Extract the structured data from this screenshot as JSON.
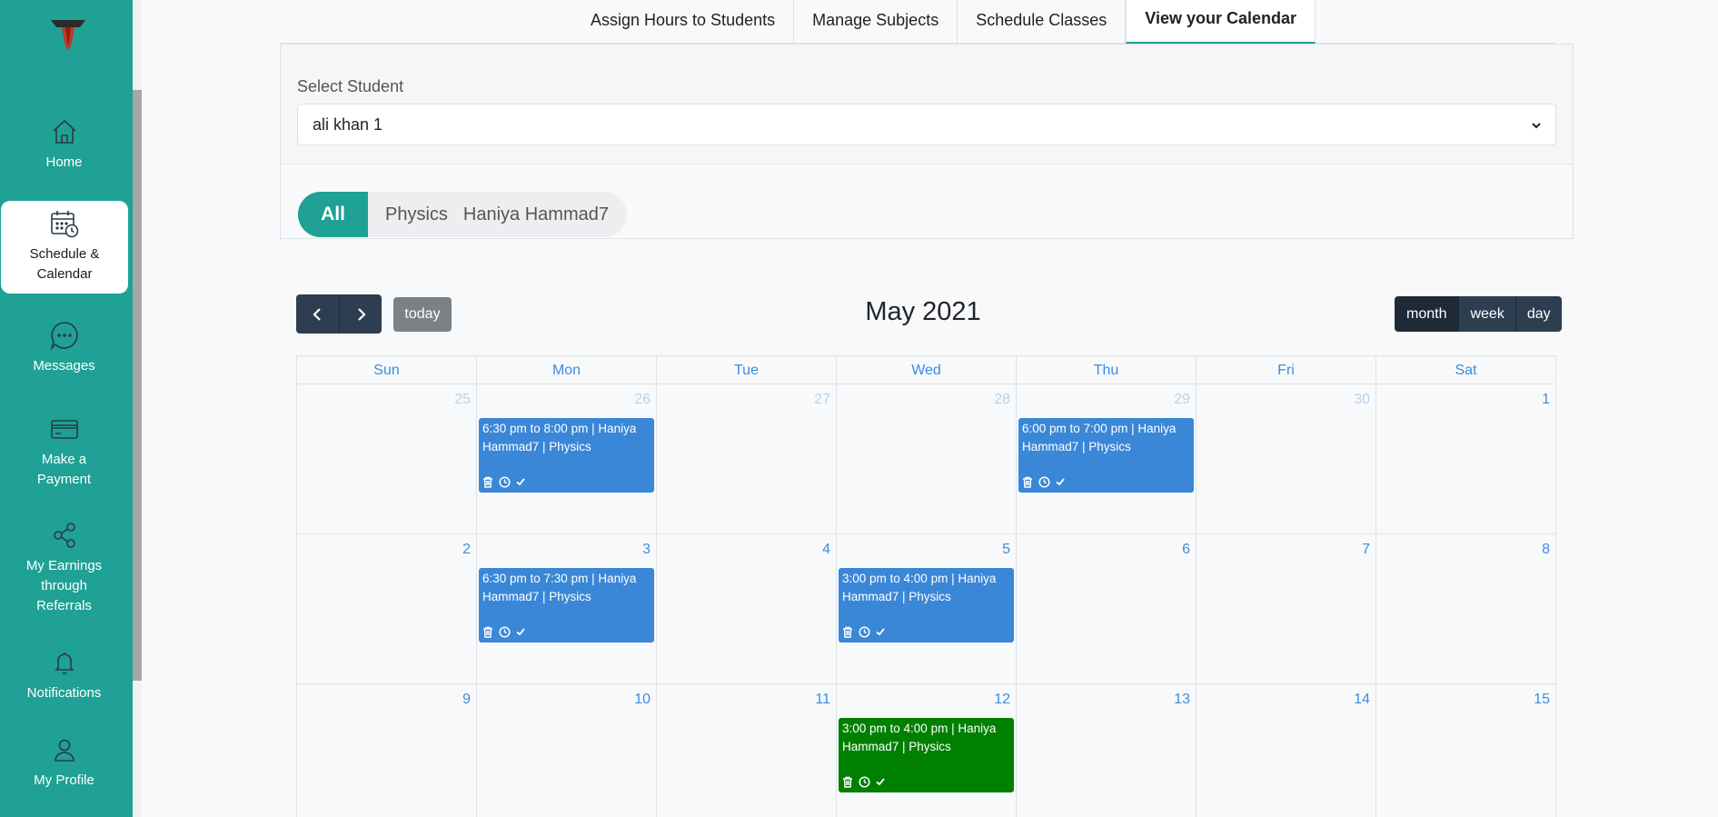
{
  "sidebar": {
    "items": [
      {
        "label": "Home",
        "icon": "home-icon"
      },
      {
        "label": "Schedule & Calendar",
        "icon": "calendar-clock-icon"
      },
      {
        "label": "Messages",
        "icon": "chat-icon"
      },
      {
        "label": "Make a Payment",
        "icon": "credit-card-icon"
      },
      {
        "label": "My Earnings through Referrals",
        "icon": "share-icon"
      },
      {
        "label": "Notifications",
        "icon": "bell-icon"
      },
      {
        "label": "My Profile",
        "icon": "user-icon"
      }
    ],
    "accent_color": "#1fa195"
  },
  "tabs": [
    {
      "label": "Assign Hours to Students"
    },
    {
      "label": "Manage Subjects"
    },
    {
      "label": "Schedule Classes"
    },
    {
      "label": "View your Calendar",
      "active": true
    }
  ],
  "filter": {
    "select_label": "Select Student",
    "selected_student": "ali khan 1",
    "pills": [
      "All",
      "Physics",
      "Haniya Hammad7"
    ]
  },
  "calendar": {
    "title": "May 2021",
    "today_label": "today",
    "views": [
      "month",
      "week",
      "day"
    ],
    "active_view": "month",
    "weekdays": [
      "Sun",
      "Mon",
      "Tue",
      "Wed",
      "Thu",
      "Fri",
      "Sat"
    ],
    "weeks": [
      [
        {
          "day": "25",
          "other": true
        },
        {
          "day": "26",
          "other": true,
          "event": {
            "text": "6:30 pm to 8:00 pm | Haniya Hammad7 | Physics",
            "color": "blue"
          }
        },
        {
          "day": "27",
          "other": true
        },
        {
          "day": "28",
          "other": true
        },
        {
          "day": "29",
          "other": true,
          "event": {
            "text": "6:00 pm to 7:00 pm | Haniya Hammad7 | Physics",
            "color": "blue"
          }
        },
        {
          "day": "30",
          "other": true
        },
        {
          "day": "1"
        }
      ],
      [
        {
          "day": "2"
        },
        {
          "day": "3",
          "event": {
            "text": "6:30 pm to 7:30 pm | Haniya Hammad7 | Physics",
            "color": "blue"
          }
        },
        {
          "day": "4"
        },
        {
          "day": "5",
          "event": {
            "text": "3:00 pm to 4:00 pm | Haniya Hammad7 | Physics",
            "color": "blue"
          }
        },
        {
          "day": "6"
        },
        {
          "day": "7"
        },
        {
          "day": "8"
        }
      ],
      [
        {
          "day": "9"
        },
        {
          "day": "10"
        },
        {
          "day": "11"
        },
        {
          "day": "12",
          "event": {
            "text": "3:00 pm to 4:00 pm | Haniya Hammad7 | Physics",
            "color": "green"
          }
        },
        {
          "day": "13"
        },
        {
          "day": "14"
        },
        {
          "day": "15"
        }
      ]
    ],
    "event_colors": {
      "blue": "#3a87d8",
      "green": "#008000"
    }
  }
}
